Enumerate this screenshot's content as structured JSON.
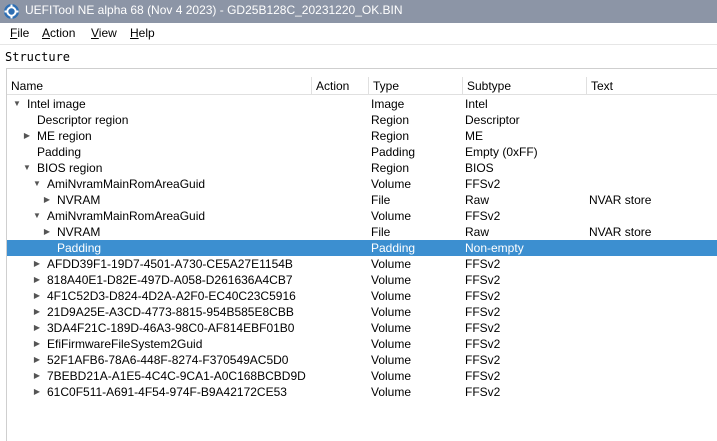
{
  "window": {
    "title": "UEFITool NE alpha 68 (Nov  4 2023) - GD25B128C_20231220_OK.BIN"
  },
  "menu": [
    {
      "label": "File",
      "accel": "F",
      "rest": "ile"
    },
    {
      "label": "Action",
      "accel": "A",
      "rest": "ction"
    },
    {
      "label": "View",
      "accel": "V",
      "rest": "iew"
    },
    {
      "label": "Help",
      "accel": "H",
      "rest": "elp"
    }
  ],
  "structure": {
    "label": "Structure",
    "columns": [
      "Name",
      "Action",
      "Type",
      "Subtype",
      "Text"
    ],
    "rows": [
      {
        "name": "Intel image",
        "action": "",
        "type": "Image",
        "subtype": "Intel",
        "text": "",
        "depth": 0,
        "expander": "expanded",
        "selected": false
      },
      {
        "name": "Descriptor region",
        "action": "",
        "type": "Region",
        "subtype": "Descriptor",
        "text": "",
        "depth": 1,
        "expander": "none",
        "selected": false
      },
      {
        "name": "ME region",
        "action": "",
        "type": "Region",
        "subtype": "ME",
        "text": "",
        "depth": 1,
        "expander": "collapsed",
        "selected": false
      },
      {
        "name": "Padding",
        "action": "",
        "type": "Padding",
        "subtype": "Empty (0xFF)",
        "text": "",
        "depth": 1,
        "expander": "none",
        "selected": false
      },
      {
        "name": "BIOS region",
        "action": "",
        "type": "Region",
        "subtype": "BIOS",
        "text": "",
        "depth": 1,
        "expander": "expanded",
        "selected": false
      },
      {
        "name": "AmiNvramMainRomAreaGuid",
        "action": "",
        "type": "Volume",
        "subtype": "FFSv2",
        "text": "",
        "depth": 2,
        "expander": "expanded",
        "selected": false
      },
      {
        "name": "NVRAM",
        "action": "",
        "type": "File",
        "subtype": "Raw",
        "text": "NVAR store",
        "depth": 3,
        "expander": "collapsed",
        "selected": false
      },
      {
        "name": "AmiNvramMainRomAreaGuid",
        "action": "",
        "type": "Volume",
        "subtype": "FFSv2",
        "text": "",
        "depth": 2,
        "expander": "expanded",
        "selected": false
      },
      {
        "name": "NVRAM",
        "action": "",
        "type": "File",
        "subtype": "Raw",
        "text": "NVAR store",
        "depth": 3,
        "expander": "collapsed",
        "selected": false
      },
      {
        "name": "Padding",
        "action": "",
        "type": "Padding",
        "subtype": "Non-empty",
        "text": "",
        "depth": 3,
        "expander": "none",
        "selected": true
      },
      {
        "name": "AFDD39F1-19D7-4501-A730-CE5A27E1154B",
        "action": "",
        "type": "Volume",
        "subtype": "FFSv2",
        "text": "",
        "depth": 2,
        "expander": "collapsed",
        "selected": false
      },
      {
        "name": "818A40E1-D82E-497D-A058-D261636A4CB7",
        "action": "",
        "type": "Volume",
        "subtype": "FFSv2",
        "text": "",
        "depth": 2,
        "expander": "collapsed",
        "selected": false
      },
      {
        "name": "4F1C52D3-D824-4D2A-A2F0-EC40C23C5916",
        "action": "",
        "type": "Volume",
        "subtype": "FFSv2",
        "text": "",
        "depth": 2,
        "expander": "collapsed",
        "selected": false
      },
      {
        "name": "21D9A25E-A3CD-4773-8815-954B585E8CBB",
        "action": "",
        "type": "Volume",
        "subtype": "FFSv2",
        "text": "",
        "depth": 2,
        "expander": "collapsed",
        "selected": false
      },
      {
        "name": "3DA4F21C-189D-46A3-98C0-AF814EBF01B0",
        "action": "",
        "type": "Volume",
        "subtype": "FFSv2",
        "text": "",
        "depth": 2,
        "expander": "collapsed",
        "selected": false
      },
      {
        "name": "EfiFirmwareFileSystem2Guid",
        "action": "",
        "type": "Volume",
        "subtype": "FFSv2",
        "text": "",
        "depth": 2,
        "expander": "collapsed",
        "selected": false
      },
      {
        "name": "52F1AFB6-78A6-448F-8274-F370549AC5D0",
        "action": "",
        "type": "Volume",
        "subtype": "FFSv2",
        "text": "",
        "depth": 2,
        "expander": "collapsed",
        "selected": false
      },
      {
        "name": "7BEBD21A-A1E5-4C4C-9CA1-A0C168BCBD9D",
        "action": "",
        "type": "Volume",
        "subtype": "FFSv2",
        "text": "",
        "depth": 2,
        "expander": "collapsed",
        "selected": false
      },
      {
        "name": "61C0F511-A691-4F54-974F-B9A42172CE53",
        "action": "",
        "type": "Volume",
        "subtype": "FFSv2",
        "text": "",
        "depth": 2,
        "expander": "collapsed",
        "selected": false
      }
    ]
  },
  "icons": {
    "app": "uefitool-gear-icon",
    "expanded": "triangle-down-icon",
    "collapsed": "triangle-right-icon"
  },
  "colors": {
    "titlebar": "#8c95a6",
    "selection": "#3c8fd0"
  }
}
